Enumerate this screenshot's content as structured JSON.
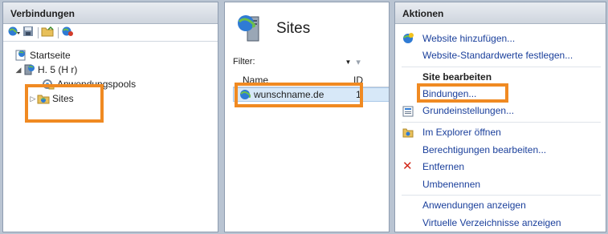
{
  "left_panel": {
    "title": "Verbindungen",
    "tree": {
      "start_page": "Startseite",
      "server": "H.        5 (H        r)",
      "app_pools": "Anwendungspools",
      "sites": "Sites"
    }
  },
  "middle_panel": {
    "title": "Sites",
    "filter_label": "Filter:",
    "columns": {
      "name": "Name",
      "id": "ID"
    },
    "rows": [
      {
        "name": "wunschname.de",
        "id": "1"
      }
    ]
  },
  "right_panel": {
    "title": "Aktionen",
    "actions": {
      "add_website": "Website hinzufügen...",
      "website_defaults": "Website-Standardwerte festlegen...",
      "edit_site_heading": "Site bearbeiten",
      "bindings": "Bindungen...",
      "basic_settings": "Grundeinstellungen...",
      "open_explorer": "Im Explorer öffnen",
      "edit_permissions": "Berechtigungen bearbeiten...",
      "remove": "Entfernen",
      "rename": "Umbenennen",
      "show_apps": "Anwendungen anzeigen",
      "show_vdirs": "Virtuelle Verzeichnisse anzeigen"
    }
  },
  "colors": {
    "highlight": "#f08a22",
    "link": "#1a3f9b",
    "selection": "#d7e8f8"
  },
  "icons": [
    "globe-icon",
    "save-icon",
    "folder-up-icon",
    "disconnect-icon",
    "server-icon",
    "start-page-icon",
    "app-pool-icon",
    "sites-folder-icon",
    "settings-icon",
    "explorer-icon",
    "remove-icon"
  ]
}
